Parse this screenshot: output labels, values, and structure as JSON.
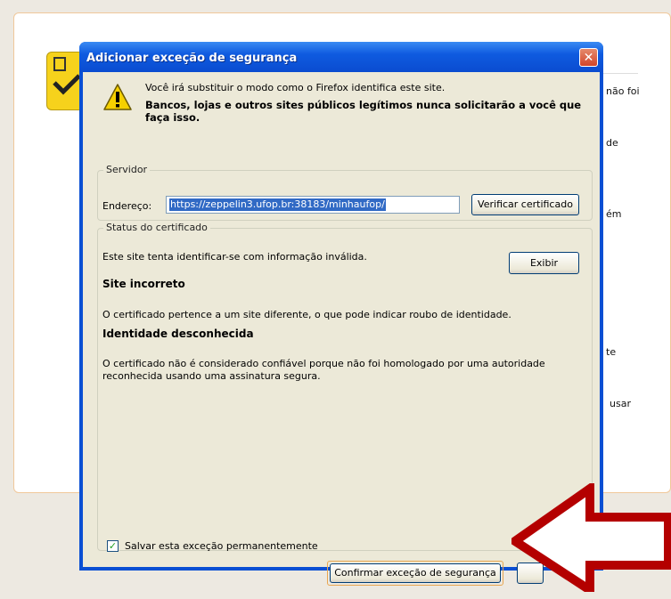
{
  "background": {
    "fragments": [
      "não foi",
      "de",
      "ém",
      "te",
      "usar"
    ]
  },
  "dialog": {
    "title": "Adicionar exceção de segurança",
    "close_glyph": "✕",
    "warning_line": "Você irá substituir o modo como o Firefox identifica este site.",
    "warning_bold": "Bancos, lojas e outros sites públicos legítimos nunca solicitarão a você que faça isso.",
    "server": {
      "group_label": "Servidor",
      "address_label": "Endereço:",
      "address_value": "https://zeppelin3.ufop.br:38183/minhaufop/",
      "verify_button": "Verificar certificado"
    },
    "status": {
      "group_label": "Status do certificado",
      "summary": "Este site tenta identificar-se com informação inválida.",
      "view_button": "Exibir",
      "heading1": "Site incorreto",
      "text1": "O certificado pertence a um site diferente, o que pode indicar roubo de identidade.",
      "heading2": "Identidade desconhecida",
      "text2": "O certificado não é considerado confiável porque não foi homologado por uma autoridade reconhecida usando uma assinatura segura."
    },
    "permanent_checkbox": {
      "label": "Salvar esta exceção permanentemente",
      "checked": true
    },
    "confirm_button": "Confirmar exceção de segurança"
  },
  "colors": {
    "titlebar": "#0a4fd3",
    "dialog_bg": "#ece9d8",
    "arrow": "#b40000"
  }
}
